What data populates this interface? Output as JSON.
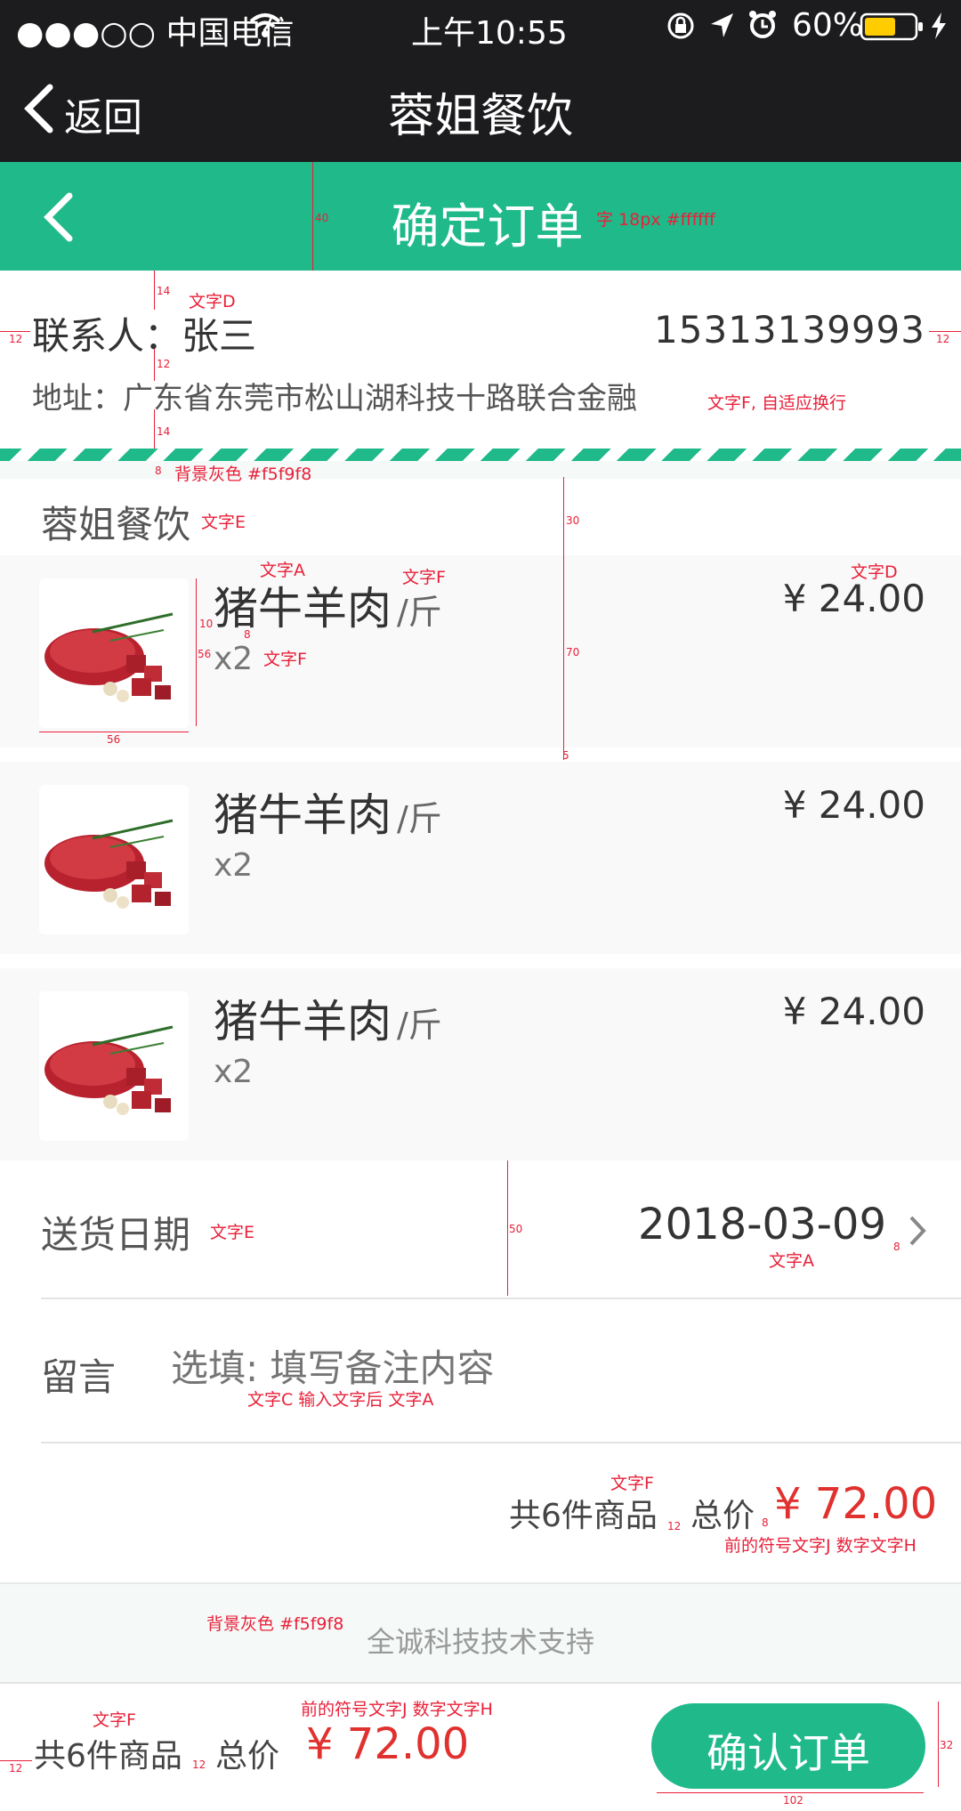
{
  "status_bar": {
    "carrier": "●●●○○ 中国电信",
    "time": "上午10:55",
    "battery": "60%"
  },
  "nav": {
    "back_label": "返回",
    "title": "蓉姐餐饮"
  },
  "header": {
    "title": "确定订单"
  },
  "contact": {
    "name": "联系人：张三",
    "phone": "15313139993",
    "address": "地址：广东省东莞市松山湖科技十路联合金融"
  },
  "store": {
    "name": "蓉姐餐饮"
  },
  "products": [
    {
      "name": "猪牛羊肉",
      "unit": "/斤",
      "qty": "x2",
      "price": "¥ 24.00"
    },
    {
      "name": "猪牛羊肉",
      "unit": "/斤",
      "qty": "x2",
      "price": "¥ 24.00"
    },
    {
      "name": "猪牛羊肉",
      "unit": "/斤",
      "qty": "x2",
      "price": "¥ 24.00"
    }
  ],
  "delivery": {
    "label": "送货日期",
    "value": "2018-03-09"
  },
  "message": {
    "label": "留言",
    "placeholder": "选填: 填写备注内容"
  },
  "summary": {
    "count": "共6件商品",
    "total_label": "总价",
    "total": "¥ 72.00"
  },
  "footer": {
    "support": "全诚科技技术支持"
  },
  "bottom_bar": {
    "count": "共6件商品",
    "total_label": "总价",
    "total": "¥ 72.00",
    "confirm": "确认订单"
  },
  "annotations": {
    "header_font": "字 18px #ffffff",
    "text_d": "文字D",
    "text_d2": "文字D",
    "address_note": "文字F, 自适应换行",
    "bg_gray": "背景灰色 #f5f9f8",
    "bg_gray2": "背景灰色 #f5f9f8",
    "text_e": "文字E",
    "text_e2": "文字E",
    "text_a": "文字A",
    "text_a2": "文字A",
    "text_f_unit": "文字F",
    "text_f_qty": "文字F",
    "text_f_sum": "文字F",
    "text_f_bottom": "文字F",
    "msg_note": "文字C  输入文字后 文字A",
    "sum_note": "前的符号文字J  数字文字H",
    "bottom_note": "前的符号文字J  数字文字H",
    "d40": "40",
    "d14a": "14",
    "d12a": "12",
    "d14b": "14",
    "d8": "8",
    "d12l": "12",
    "d12r": "12",
    "d30": "30",
    "d70": "70",
    "d5": "5",
    "d10": "10",
    "d8b": "8",
    "d56v": "56",
    "d56h": "56",
    "d50": "50",
    "d8c": "8",
    "d12s": "12",
    "d8s": "8",
    "d12bl": "12",
    "d12bm": "12",
    "d32": "32",
    "d102": "102"
  },
  "colors": {
    "accent": "#1fb98a",
    "price_red": "#e0312e",
    "bar_dark": "#1c1c1e",
    "annotation": "#e8213a",
    "bg_gray": "#f5f9f8"
  }
}
